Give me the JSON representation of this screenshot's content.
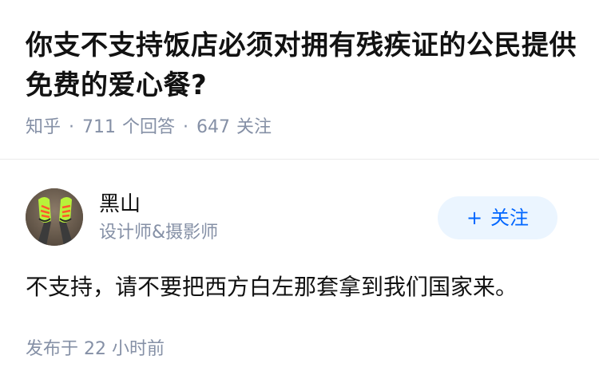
{
  "question": {
    "title": "你支不支持饭店必须对拥有残疾证的公民提供免费的爱心餐?",
    "source": "知乎",
    "answer_count": "711",
    "answer_label": "个回答",
    "follower_count": "647",
    "follower_label": "关注"
  },
  "answer": {
    "author": {
      "name": "黑山",
      "bio": "设计师&摄影师",
      "avatar": "avatar-photo"
    },
    "follow_button": {
      "icon": "plus-icon",
      "label": "关注"
    },
    "content": "不支持，请不要把西方白左那套拿到我们国家来。",
    "time_prefix": "发布于",
    "time_value": "22 小时前"
  },
  "colors": {
    "text": "#121212",
    "meta": "#8590a6",
    "accent": "#0066ff",
    "button_bg": "#ebf5ff",
    "divider": "#ebebeb"
  }
}
